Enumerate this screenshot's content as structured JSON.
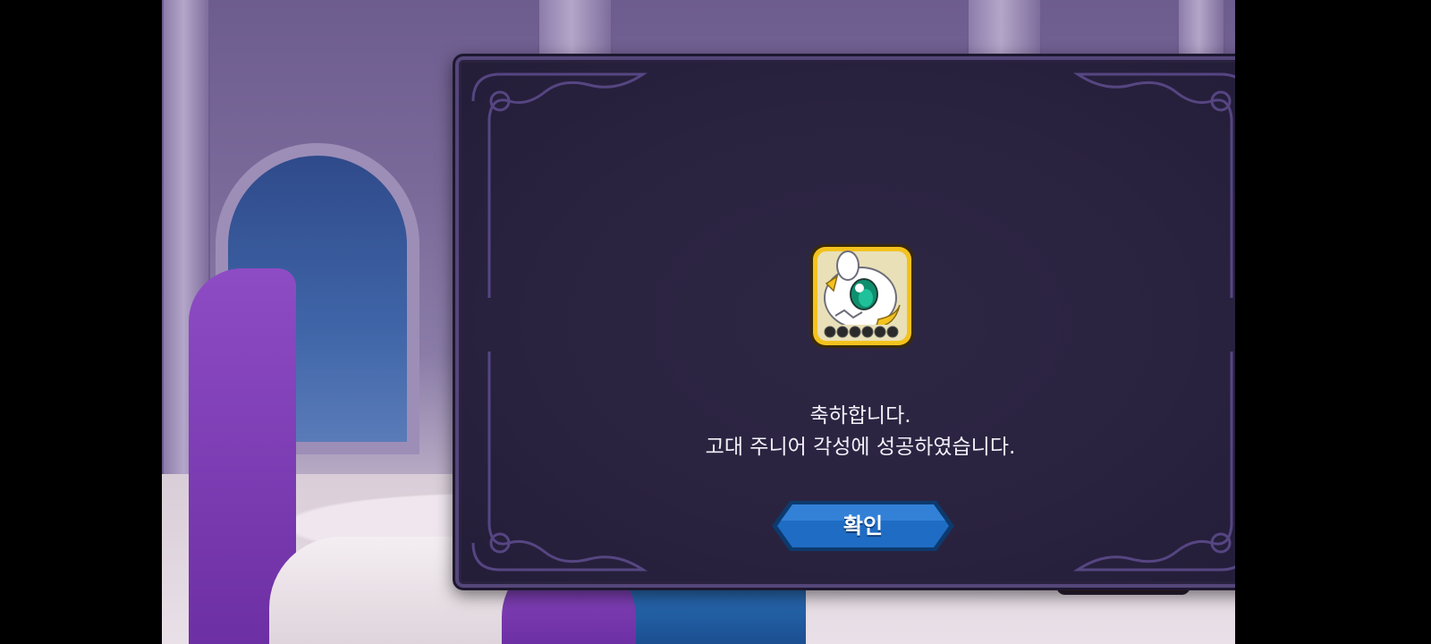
{
  "dialog": {
    "title_line": "축하합니다.",
    "message_line": "고대 주니어 각성에 성공하였습니다.",
    "confirm_label": "확인"
  },
  "reward": {
    "icon": "white-dragon-pet-icon",
    "stars_total": 6,
    "stars_filled": 0
  },
  "controls": {
    "close_icon": "close-x-icon"
  },
  "colors": {
    "dialog_bg": "#2a2340",
    "dialog_border": "#55467a",
    "confirm_button": "#1f6cc4",
    "close_button": "#b2222a",
    "icon_frame": "#f3c21e",
    "text": "#f3f0f8"
  }
}
